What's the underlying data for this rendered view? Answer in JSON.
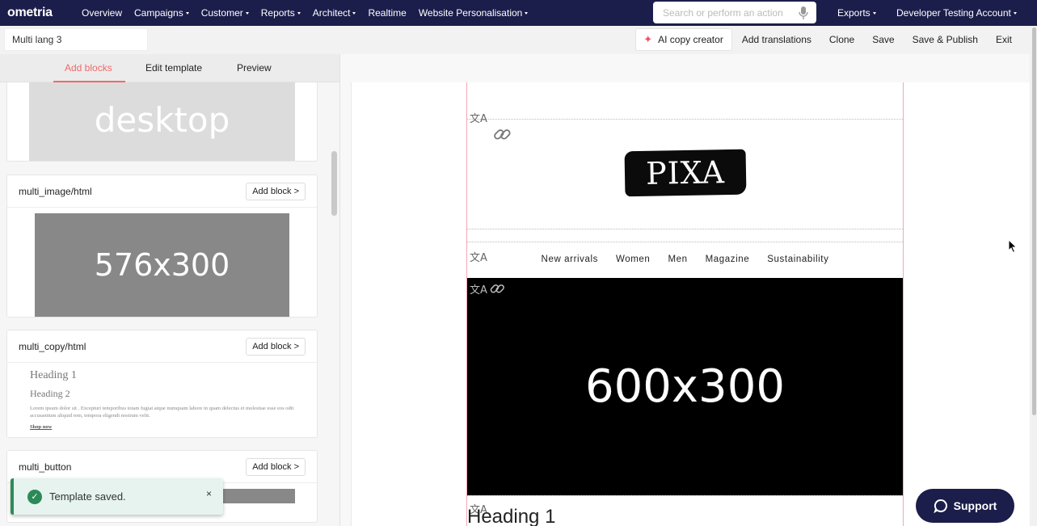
{
  "nav": {
    "logo": "ometria",
    "items": [
      {
        "label": "Overview",
        "caret": false
      },
      {
        "label": "Campaigns",
        "caret": true
      },
      {
        "label": "Customer",
        "caret": true
      },
      {
        "label": "Reports",
        "caret": true
      },
      {
        "label": "Architect",
        "caret": true
      },
      {
        "label": "Realtime",
        "caret": false
      },
      {
        "label": "Website Personalisation",
        "caret": true
      }
    ],
    "search_placeholder": "Search or perform an action",
    "exports_label": "Exports",
    "account_label": "Developer Testing Account"
  },
  "subbar": {
    "template_name": "Multi lang 3",
    "ai_label": "AI copy creator",
    "actions": [
      "Add translations",
      "Clone",
      "Save",
      "Save & Publish",
      "Exit"
    ]
  },
  "left": {
    "tabs": [
      "Add blocks",
      "Edit template",
      "Preview"
    ],
    "active_tab": "Add blocks",
    "desktop_text": "desktop",
    "blocks": [
      {
        "title": "multi_image/html",
        "button": "Add block >",
        "preview_text": "576x300"
      },
      {
        "title": "multi_copy/html",
        "button": "Add block >",
        "heading1": "Heading 1",
        "heading2": "Heading 2",
        "body": "Lorem ipsum dolor sit . Excepturi temporibus totam fugiat atque numquam labore in quam delectus et molestiae esse eos odit accusantium aliquid rem, tempora eligendi nostrum velit.",
        "link": "Shop now"
      },
      {
        "title": "multi_button",
        "button": "Add block >"
      }
    ]
  },
  "toast": {
    "message": "Template saved.",
    "close": "×"
  },
  "email": {
    "logo_text": "PIXA",
    "menu": [
      "New arrivals",
      "Women",
      "Men",
      "Magazine",
      "Sustainability"
    ],
    "hero_text": "600x300",
    "heading": "Heading 1"
  },
  "support_label": "Support",
  "colors": {
    "nav_bg": "#1b1d4a",
    "accent": "#f06a6a",
    "success": "#2b8a58"
  }
}
